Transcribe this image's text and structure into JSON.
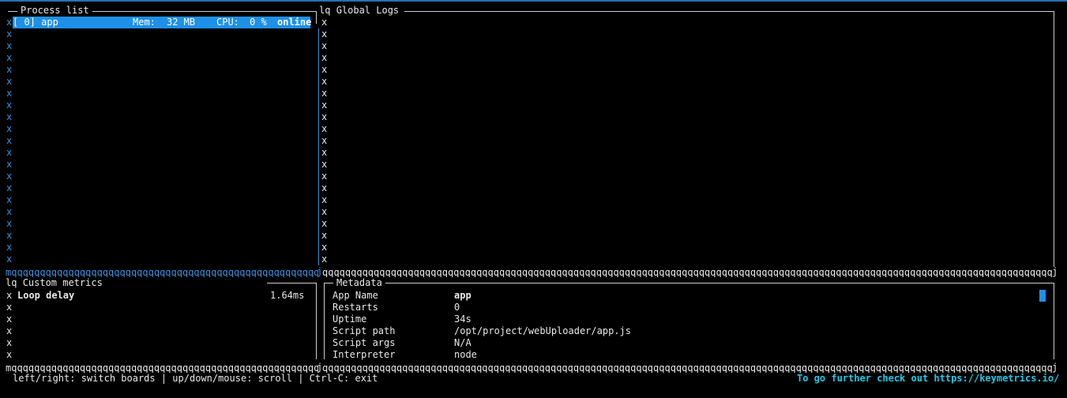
{
  "colors": {
    "accent": "#1e90e8",
    "border_blue": "#3a8fe0",
    "link": "#1ec8e8"
  },
  "process_panel": {
    "title": "Process list",
    "process": {
      "id": "[ 0] app",
      "mem_label": "Mem:",
      "mem_value": "32 MB",
      "cpu_label": "CPU:",
      "cpu_value": "0 %",
      "status": "online"
    }
  },
  "logs_panel": {
    "title_prefix": "lq",
    "title": "Global Logs"
  },
  "metrics_panel": {
    "title_prefix": "lq",
    "title": "Custom metrics",
    "metric_name": "Loop delay",
    "metric_value": "1.64ms"
  },
  "metadata_panel": {
    "title": "Metadata",
    "rows": [
      {
        "key": "App Name",
        "value": "app"
      },
      {
        "key": "Restarts",
        "value": "0"
      },
      {
        "key": "Uptime",
        "value": "34s"
      },
      {
        "key": "Script path",
        "value": "/opt/project/webUploader/app.js"
      },
      {
        "key": "Script args",
        "value": "N/A"
      },
      {
        "key": "Interpreter",
        "value": "node"
      }
    ]
  },
  "border_chars": {
    "vertical": "x",
    "horizontal": "qqqqqqqqqqqqqqqqqqqqqqqqqqqqqqqqqqqqqqqqqqqqqqqqqqqqqqqqqqqqqqqqqqqqqqqqqqqqqqqqqqqqqqqqqqqqqqqqqqqqqqqqqqqqqqqqqqqqqqqqqqqqqqqqqqqqqqqqqqqqqqqqqqqqqqqqqqqqqqqqqqqqqqqqqqqqqqqqqqqqqqqqqqqqqqqqqqqqqqqqqqqqqqqqqqqqqqqqqqqqqqqqqqqqqqqqqqqqqqqqqqqqqqqq",
    "corner_bl": "m",
    "corner_br": "j"
  },
  "footer": {
    "help": "left/right: switch boards | up/down/mouse: scroll | Ctrl-C: exit",
    "link": "To go further check out https://keymetrics.io/"
  }
}
